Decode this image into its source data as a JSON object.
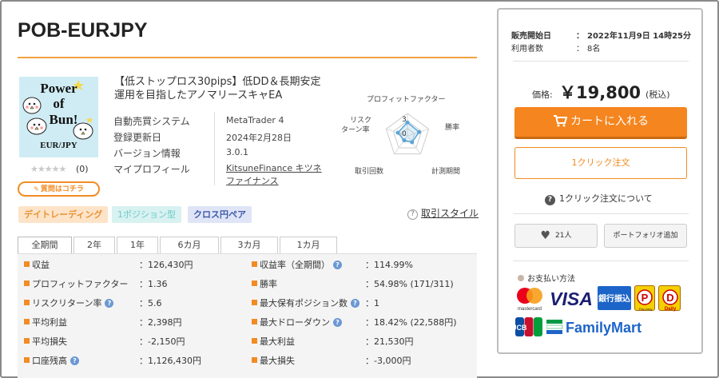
{
  "product": {
    "title": "POB-EURJPY",
    "description": "【低ストップロス30pips】低DD＆長期安定運用を目指したアノマリースキャEA",
    "thumbnail_lines": [
      "Power",
      "of",
      "Bun!",
      "EUR/JPY"
    ],
    "rating_stars": "★★★★★",
    "review_count": "(0)",
    "question_button": "質問はコチラ"
  },
  "specs": [
    {
      "label": "自動売買システム",
      "value": "MetaTrader 4"
    },
    {
      "label": "登録更新日",
      "value": "2024年2月28日"
    },
    {
      "label": "バージョン情報",
      "value": "3.0.1"
    },
    {
      "label": "マイプロフィール",
      "value": "KitsuneFinance キツネファイナンス"
    }
  ],
  "radar": {
    "labels": {
      "profit_factor": "プロフィットファクター",
      "win_rate": "勝率",
      "period": "計測期間",
      "trades": "取引回数",
      "risk_line1": "リスク",
      "risk_line2": "ターン率"
    },
    "scale_max": "3",
    "scale_zero": "0",
    "values": {
      "profit_factor": 0.6,
      "win_rate": 0.55,
      "period": 0.35,
      "trades": 0.25,
      "risk_return": 0.45
    },
    "color": "#5aa6d6"
  },
  "tags": [
    "デイトレーディング",
    "1ポジション型",
    "クロス円ペア"
  ],
  "trade_style_link": "取引スタイル",
  "tabs": [
    "全期間",
    "2年",
    "1年",
    "6カ月",
    "3カ月",
    "1カ月"
  ],
  "stats_left": [
    {
      "label": "収益",
      "value": "126,430円",
      "info": false
    },
    {
      "label": "プロフィットファクター",
      "value": "1.36",
      "info": false
    },
    {
      "label": "リスクリターン率",
      "value": "5.6",
      "info": true
    },
    {
      "label": "平均利益",
      "value": "2,398円",
      "info": false
    },
    {
      "label": "平均損失",
      "value": "-2,150円",
      "info": false
    },
    {
      "label": "口座残高",
      "value": "1,126,430円",
      "info": true
    }
  ],
  "stats_right": [
    {
      "label": "収益率（全期間）",
      "value": "114.99%",
      "info": true
    },
    {
      "label": "勝率",
      "value": "54.98% (171/311)",
      "info": false
    },
    {
      "label": "最大保有ポジション数",
      "value": "1",
      "info": true
    },
    {
      "label": "最大ドローダウン",
      "value": "18.42% (22,588円)",
      "info": true
    },
    {
      "label": "最大利益",
      "value": "21,530円",
      "info": false
    },
    {
      "label": "最大損失",
      "value": "-3,000円",
      "info": false
    }
  ],
  "stat_separator": "：",
  "sidebar": {
    "sale_start_label": "販売開始日",
    "sale_start_value": "2022年11月9日 14時25分",
    "users_label": "利用者数",
    "users_value": "8名",
    "colon": "：",
    "price_label": "価格:",
    "price": "￥19,800",
    "tax": "(税込)",
    "cart_button": "カートに入れる",
    "oneclick_button": "1クリック注文",
    "oneclick_info": "1クリック注文について",
    "favorite_count": "21人",
    "portfolio_button": "ポートフォリオ追加",
    "payment_title": "お支払い方法",
    "payment_methods": [
      "mastercard",
      "VISA",
      "銀行振込",
      "Pay-easy",
      "Daily",
      "JCB",
      "FamilyMart"
    ]
  },
  "colors": {
    "accent": "#f28b23",
    "cart": "#f5851f",
    "tag_orange": "#e89236",
    "tag_teal": "#6ccbc8",
    "tag_blue": "#3f5aa8",
    "info": "#6b98d3"
  }
}
